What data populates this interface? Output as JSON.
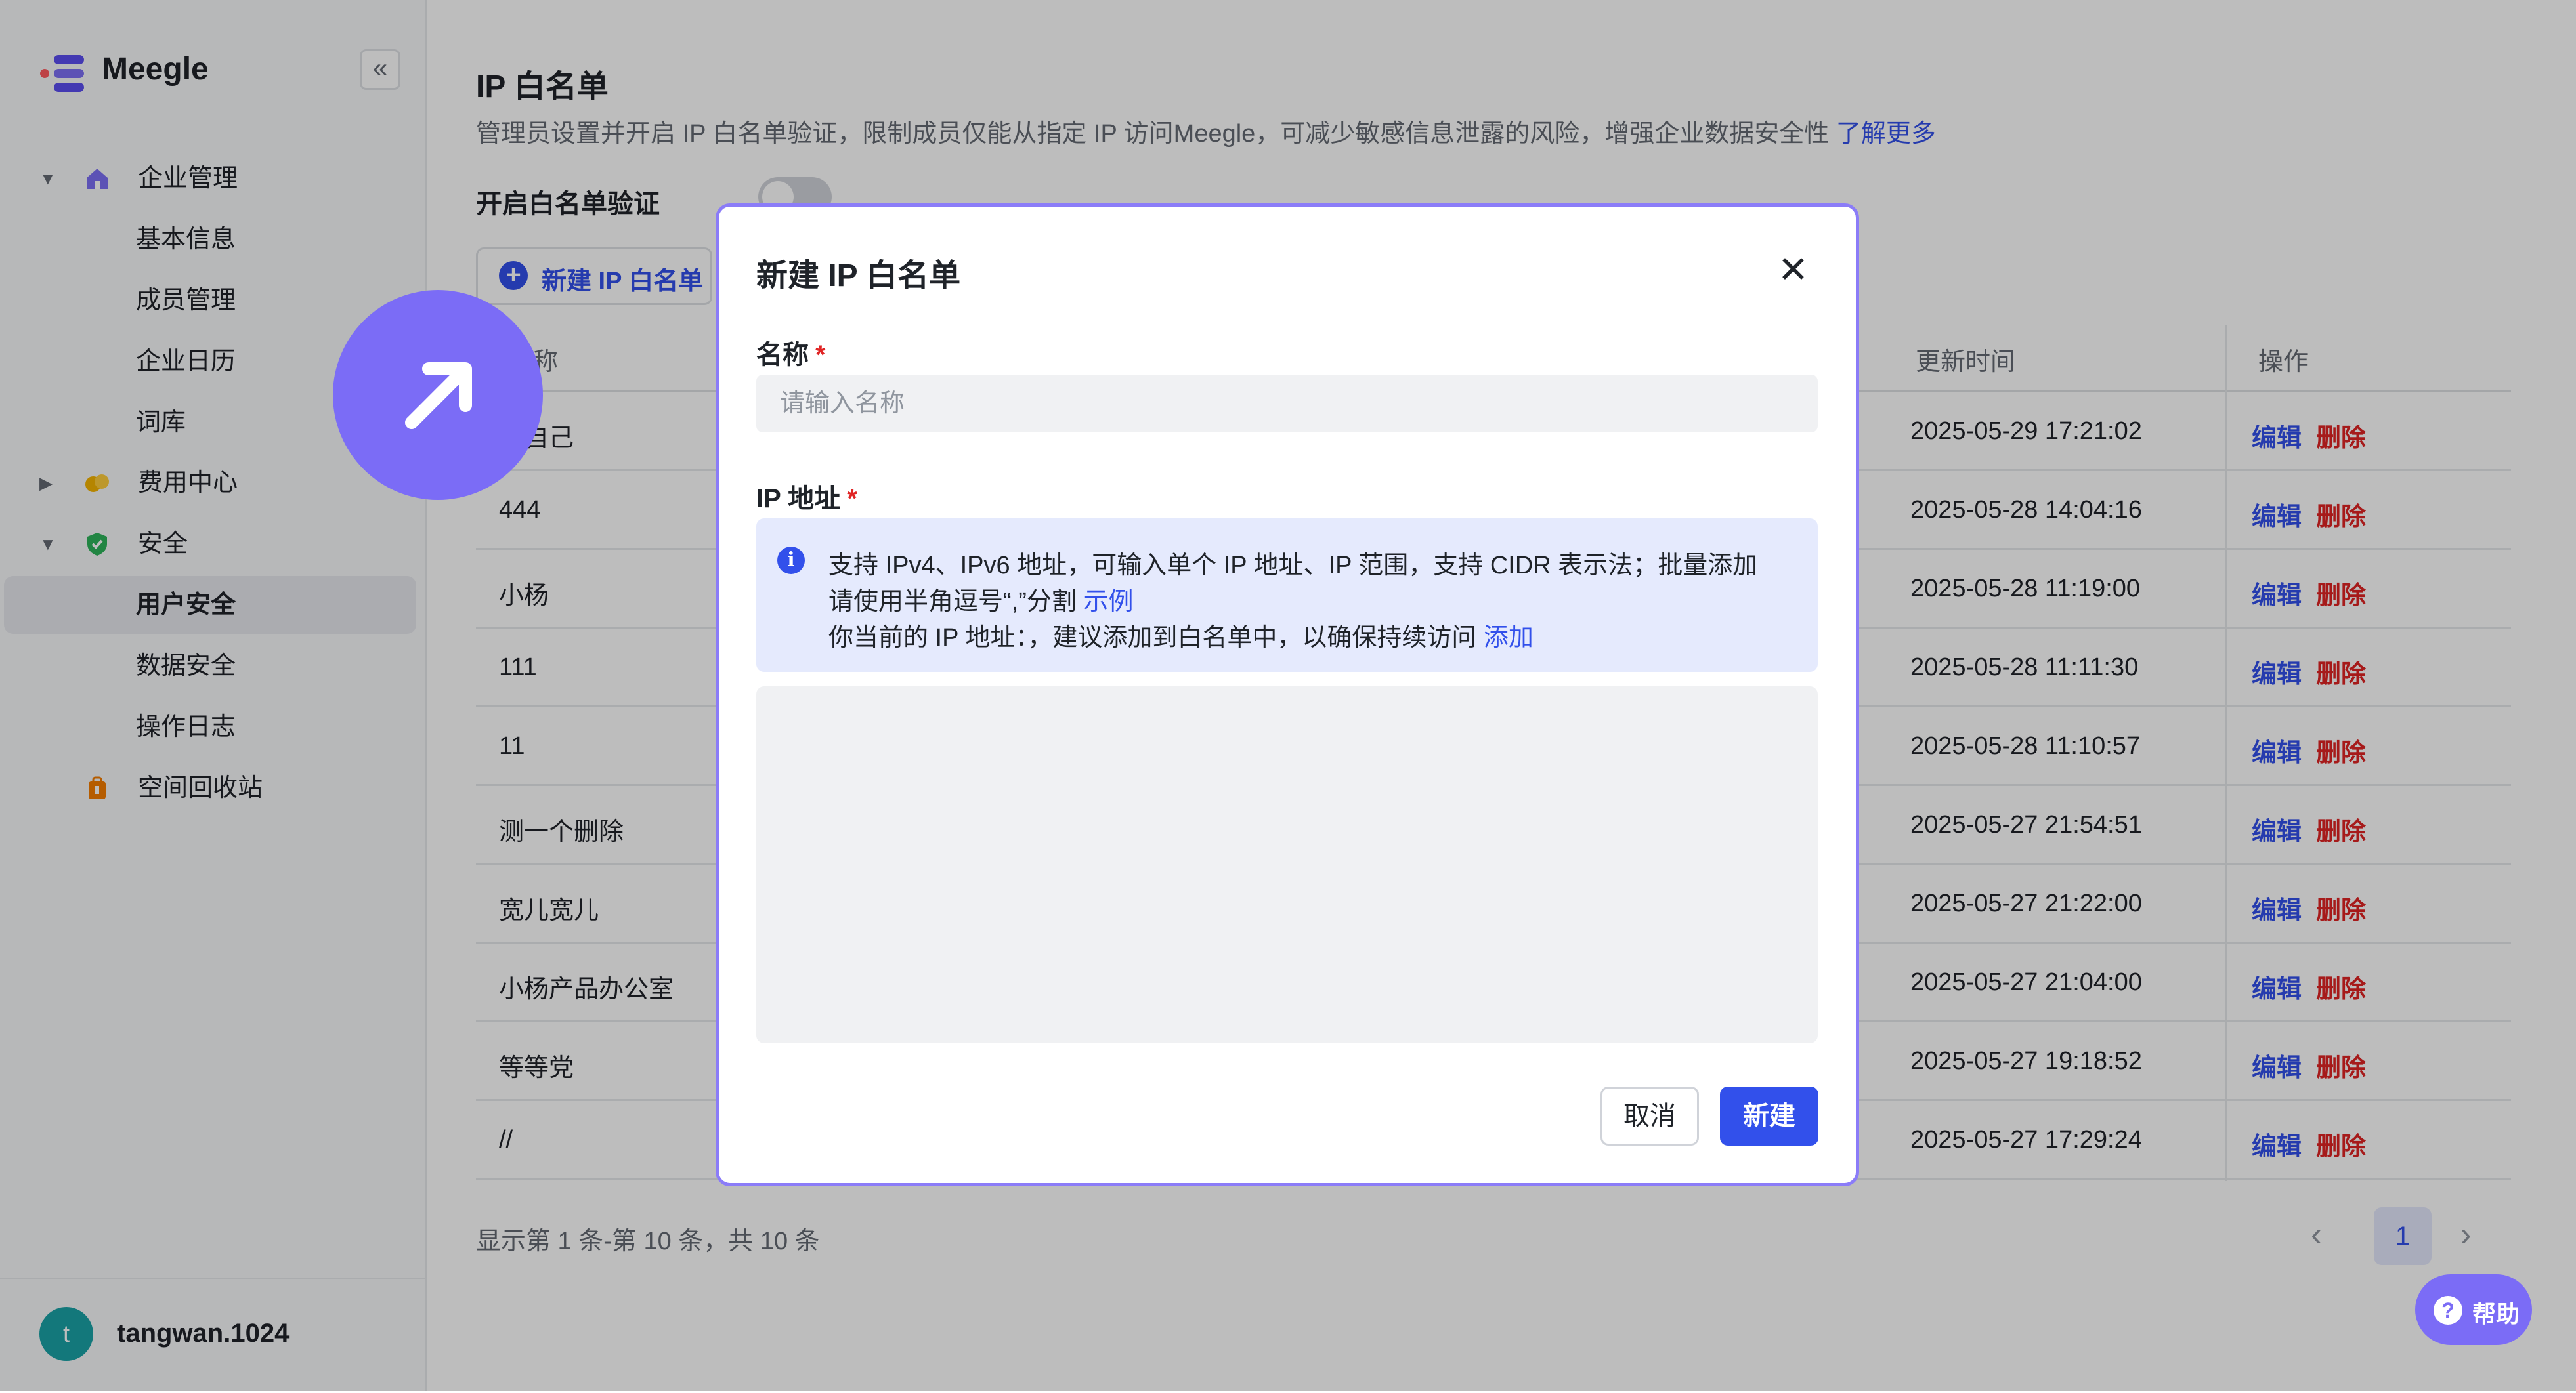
{
  "brand": {
    "name": "Meegle",
    "collapse_icon": "«"
  },
  "sidebar": {
    "items": [
      {
        "label": "企业管理",
        "icon": "home-icon",
        "expanded": true
      },
      {
        "label": "基本信息"
      },
      {
        "label": "成员管理"
      },
      {
        "label": "企业日历"
      },
      {
        "label": "词库"
      },
      {
        "label": "费用中心",
        "icon": "coins-icon",
        "expanded": false
      },
      {
        "label": "安全",
        "icon": "shield-icon",
        "expanded": true
      },
      {
        "label": "用户安全",
        "active": true
      },
      {
        "label": "数据安全"
      },
      {
        "label": "操作日志"
      },
      {
        "label": "空间回收站",
        "icon": "trash-icon"
      }
    ],
    "user": {
      "avatar_letter": "t",
      "name": "tangwan.1024"
    }
  },
  "page": {
    "title": "IP 白名单",
    "description": "管理员设置并开启 IP 白名单验证，限制成员仅能从指定 IP 访问Meegle，可减少敏感信息泄露的风险，增强企业数据安全性 ",
    "learn_more": "了解更多",
    "toggle_label": "开启白名单验证",
    "toggle_on": false,
    "new_button": "新建 IP 白名单"
  },
  "table": {
    "columns": {
      "name": "名称",
      "updated": "更新时间",
      "actions": "操作"
    },
    "partial_name_header": "称",
    "rows": [
      {
        "name": "杨自己",
        "updated": "2025-05-29 17:21:02"
      },
      {
        "name": "444",
        "updated": "2025-05-28 14:04:16"
      },
      {
        "name": "小杨",
        "updated": "2025-05-28 11:19:00"
      },
      {
        "name": "111",
        "updated": "2025-05-28 11:11:30"
      },
      {
        "name": "11",
        "updated": "2025-05-28 11:10:57"
      },
      {
        "name": "测一个删除",
        "updated": "2025-05-27 21:54:51"
      },
      {
        "name": "宽儿宽儿",
        "updated": "2025-05-27 21:22:00"
      },
      {
        "name": "小杨产品办公室",
        "updated": "2025-05-27 21:04:00"
      },
      {
        "name": "等等党",
        "updated": "2025-05-27 19:18:52"
      },
      {
        "name": "//",
        "updated": "2025-05-27 17:29:24"
      }
    ],
    "edit_label": "编辑",
    "delete_label": "删除"
  },
  "pagination": {
    "summary": "显示第 1 条-第 10 条，共 10 条",
    "current_page": "1"
  },
  "modal": {
    "title": "新建 IP 白名单",
    "name_label": "名称",
    "name_placeholder": "请输入名称",
    "name_value": "",
    "ip_label": "IP 地址",
    "required_mark": "*",
    "info_line1": "支持 IPv4、IPv6 地址，可输入单个 IP 地址、IP 范围，支持 CIDR 表示法；批量添加",
    "info_line2": "请使用半角逗号“,”分割 ",
    "example_link": "示例",
    "info_line3": "你当前的 IP 地址：，建议添加到白名单中，以确保持续访问 ",
    "add_link": "添加",
    "ip_value": "",
    "cancel": "取消",
    "create": "新建"
  },
  "help": {
    "label": "帮助"
  },
  "colors": {
    "accent": "#3250eb",
    "danger": "#e02424",
    "badge": "#7b6cf6"
  }
}
